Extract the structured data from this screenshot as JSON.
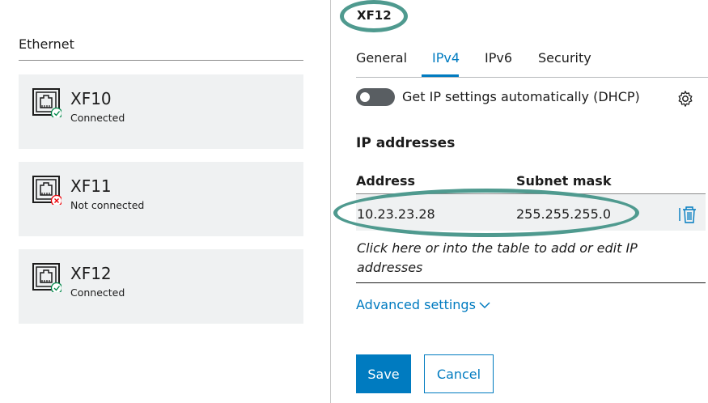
{
  "left": {
    "section_title": "Ethernet",
    "cards": [
      {
        "name": "XF10",
        "status": "Connected",
        "status_type": "ok"
      },
      {
        "name": "XF11",
        "status": "Not connected",
        "status_type": "error"
      },
      {
        "name": "XF12",
        "status": "Connected",
        "status_type": "ok"
      }
    ]
  },
  "panel": {
    "title": "XF12",
    "tabs": [
      {
        "label": "General"
      },
      {
        "label": "IPv4"
      },
      {
        "label": "IPv6"
      },
      {
        "label": "Security"
      }
    ],
    "active_tab": "IPv4",
    "dhcp_label": "Get IP settings automatically (DHCP)",
    "dhcp_enabled": false,
    "ip_heading": "IP addresses",
    "table": {
      "headers": {
        "address": "Address",
        "subnet": "Subnet mask"
      },
      "rows": [
        {
          "address": "10.23.23.28",
          "subnet": "255.255.255.0"
        }
      ]
    },
    "hint": "Click here or into the table to add or edit IP addresses",
    "advanced_label": "Advanced settings",
    "save_label": "Save",
    "cancel_label": "Cancel"
  },
  "colors": {
    "accent": "#007bc0",
    "ok": "#00884a",
    "error": "#ed0007",
    "annotation": "#4f9a8f",
    "card_bg": "#eff1f2"
  },
  "icons": {
    "ethernet": "ethernet-port-icon",
    "ok": "check-circle-icon",
    "error": "x-circle-icon",
    "settings": "gear-icon",
    "delete": "trash-icon",
    "expand": "chevron-down-icon"
  }
}
